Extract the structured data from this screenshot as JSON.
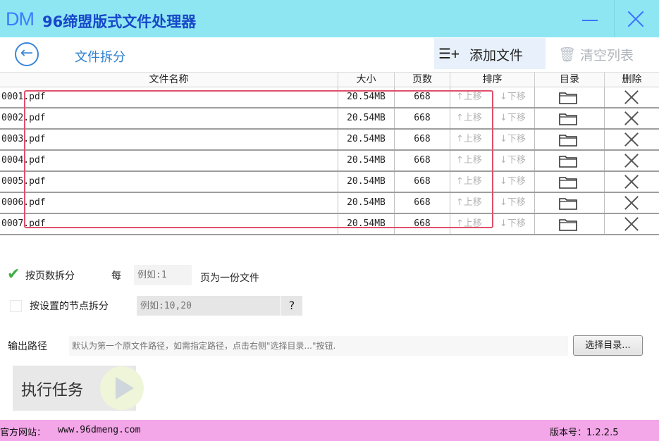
{
  "app": {
    "logo": "DM",
    "title": "96缔盟版式文件处理器"
  },
  "toolbar": {
    "page_title": "文件拆分",
    "add_file_label": "添加文件",
    "clear_list_label": "清空列表"
  },
  "table": {
    "headers": [
      "文件名称",
      "大小",
      "页数",
      "排序",
      "目录",
      "删除"
    ],
    "rows": [
      {
        "name": "0001.pdf",
        "size": "20.54MB",
        "pages": "668",
        "up": "↑上移",
        "down": "↓下移"
      },
      {
        "name": "0002.pdf",
        "size": "20.54MB",
        "pages": "668",
        "up": "↑上移",
        "down": "↓下移"
      },
      {
        "name": "0003.pdf",
        "size": "20.54MB",
        "pages": "668",
        "up": "↑上移",
        "down": "↓下移"
      },
      {
        "name": "0004.pdf",
        "size": "20.54MB",
        "pages": "668",
        "up": "↑上移",
        "down": "↓下移"
      },
      {
        "name": "0005.pdf",
        "size": "20.54MB",
        "pages": "668",
        "up": "↑上移",
        "down": "↓下移"
      },
      {
        "name": "0006.pdf",
        "size": "20.54MB",
        "pages": "668",
        "up": "↑上移",
        "down": "↓下移"
      },
      {
        "name": "0007.pdf",
        "size": "20.54MB",
        "pages": "668",
        "up": "↑上移",
        "down": "↓下移"
      }
    ]
  },
  "options": {
    "split_by_pages": {
      "label": "按页数拆分",
      "checked": true,
      "per_label": "每",
      "placeholder": "例如:1",
      "suffix": "页为一份文件"
    },
    "split_by_nodes": {
      "label": "按设置的节点拆分",
      "checked": false,
      "placeholder": "例如:10,20",
      "help": "?"
    }
  },
  "output": {
    "label": "输出路径",
    "placeholder": "默认为第一个原文件路径，如需指定路径，点击右侧\"选择目录...\"按钮.",
    "choose_label": "选择目录..."
  },
  "execute": {
    "label": "执行任务"
  },
  "footer": {
    "site_label": "官方网站：",
    "site_url": "www.96dmeng.com",
    "version": "版本号：1.2.2.5"
  },
  "colors": {
    "titlebar": "#8ee6f2",
    "accent": "#1747c9",
    "highlight": "#e0506a",
    "footer": "#f3a6e8"
  }
}
